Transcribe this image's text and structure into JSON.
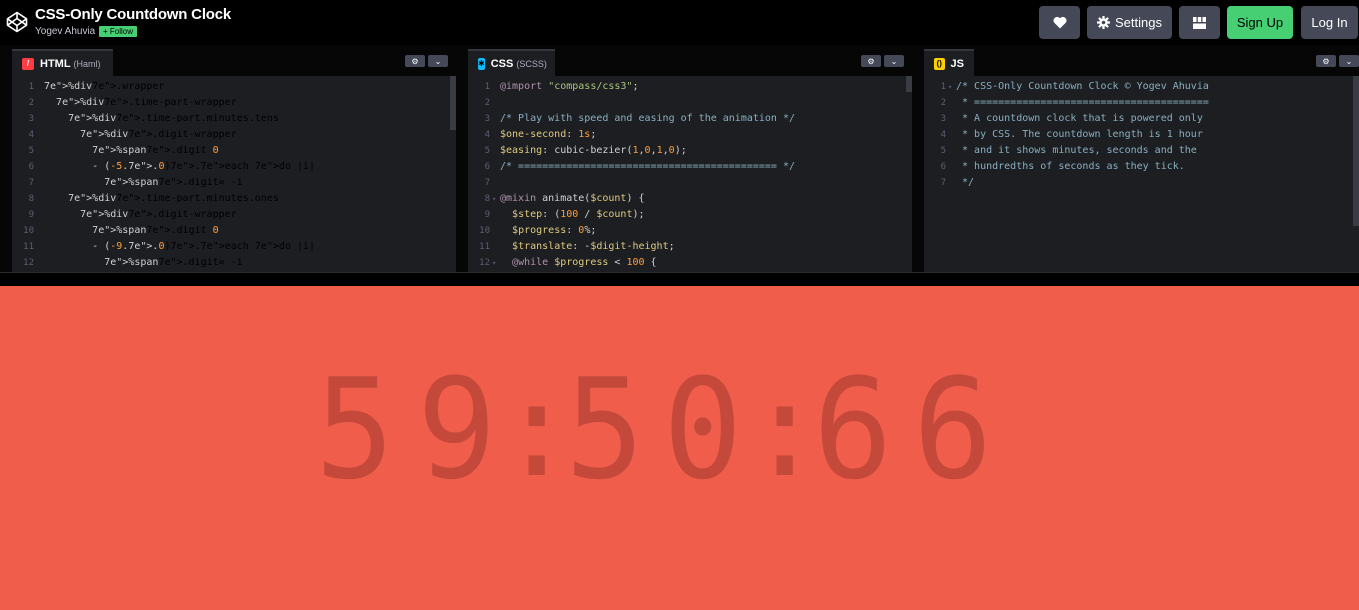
{
  "header": {
    "title": "CSS-Only Countdown Clock",
    "author": "Yogev Ahuvia",
    "follow_label": "+ Follow",
    "heart_icon": "heart-icon",
    "settings_label": "Settings",
    "signup_label": "Sign Up",
    "login_label": "Log In"
  },
  "panels": {
    "html": {
      "label": "HTML",
      "sub": "(Haml)",
      "icon_color": "#ff3c41",
      "lines": [
        {
          "n": "1",
          "t": "%div.wrapper"
        },
        {
          "n": "2",
          "t": "  %div.time-part-wrapper"
        },
        {
          "n": "3",
          "t": "    %div.time-part.minutes.tens"
        },
        {
          "n": "4",
          "t": "      %div.digit-wrapper"
        },
        {
          "n": "5",
          "t": "        %span.digit 0"
        },
        {
          "n": "6",
          "t": "        - (-5..0).each do |i|"
        },
        {
          "n": "7",
          "t": "          %span.digit= -i"
        },
        {
          "n": "8",
          "t": "    %div.time-part.minutes.ones"
        },
        {
          "n": "9",
          "t": "      %div.digit-wrapper"
        },
        {
          "n": "10",
          "t": "        %span.digit 0"
        },
        {
          "n": "11",
          "t": "        - (-9..0).each do |i|"
        },
        {
          "n": "12",
          "t": "          %span.digit= -i"
        }
      ]
    },
    "css": {
      "label": "CSS",
      "sub": "(SCSS)",
      "icon_color": "#0ebeff",
      "lines": [
        {
          "n": "1",
          "t": "@import \"compass/css3\";"
        },
        {
          "n": "2",
          "t": ""
        },
        {
          "n": "3",
          "t": "/* Play with speed and easing of the animation */"
        },
        {
          "n": "4",
          "t": "$one-second: 1s;"
        },
        {
          "n": "5",
          "t": "$easing: cubic-bezier(1,0,1,0);"
        },
        {
          "n": "6",
          "t": "/* =========================================== */"
        },
        {
          "n": "7",
          "t": ""
        },
        {
          "n": "8",
          "t": "@mixin animate($count) {"
        },
        {
          "n": "9",
          "t": "  $step: (100 / $count);"
        },
        {
          "n": "10",
          "t": "  $progress: 0%;"
        },
        {
          "n": "11",
          "t": "  $translate: -$digit-height;"
        },
        {
          "n": "12",
          "t": "  @while $progress < 100 {"
        }
      ]
    },
    "js": {
      "label": "JS",
      "sub": "",
      "icon_color": "#fcd000",
      "lines": [
        {
          "n": "1",
          "t": "/* CSS-Only Countdown Clock © Yogev Ahuvia"
        },
        {
          "n": "2",
          "t": " * ======================================="
        },
        {
          "n": "3",
          "t": " * A countdown clock that is powered only"
        },
        {
          "n": "4",
          "t": " * by CSS. The countdown length is 1 hour"
        },
        {
          "n": "5",
          "t": " * and it shows minutes, seconds and the"
        },
        {
          "n": "6",
          "t": " * hundredths of seconds as they tick."
        },
        {
          "n": "7",
          "t": " */"
        }
      ]
    }
  },
  "clock": {
    "minutes_tens": "5",
    "minutes_ones": "9",
    "sep1": ":",
    "seconds_tens": "5",
    "seconds_ones": "0",
    "sep2": ":",
    "hundredths_tens": "6",
    "hundredths_ones": "6"
  },
  "colors": {
    "result_bg": "#f05e4b",
    "digit": "#c5493a",
    "accent_green": "#47cf73"
  }
}
